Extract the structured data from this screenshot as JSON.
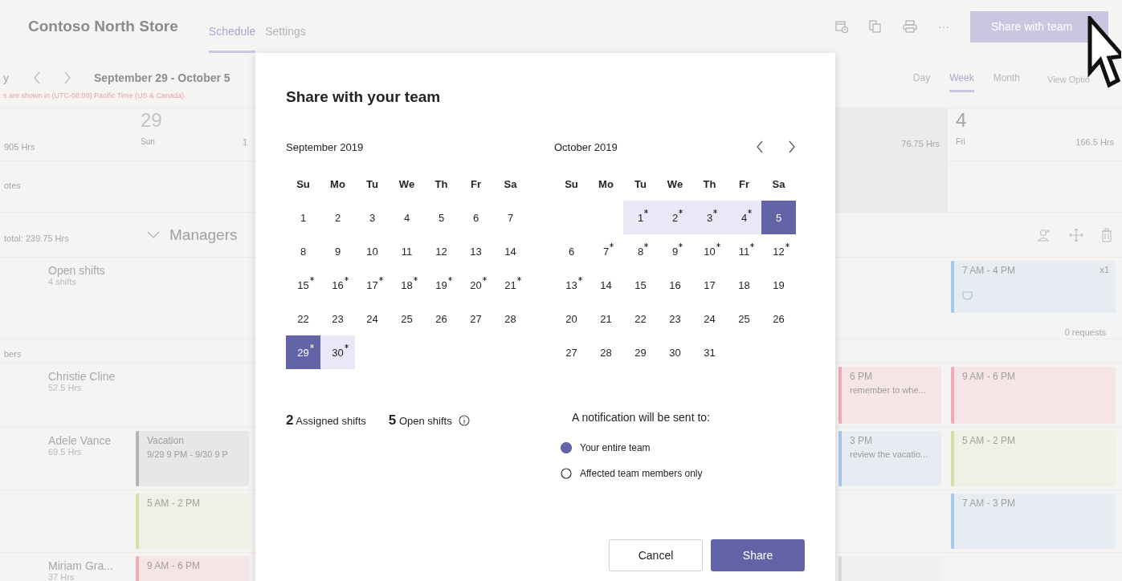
{
  "topbar": {
    "title": "Contoso North Store",
    "tabs": [
      {
        "label": "Schedule",
        "selected": true
      },
      {
        "label": "Settings",
        "selected": false
      }
    ],
    "more": "···",
    "share_button": "Share with team"
  },
  "toolbar": {
    "today_fragment": "y",
    "date_range": "September 29 - October 5",
    "timezone_note": "s are shown in (UTC-08:00) Pacific Time (US & Canada).",
    "views": [
      {
        "label": "Day",
        "selected": false
      },
      {
        "label": "Week",
        "selected": true
      },
      {
        "label": "Month",
        "selected": false
      }
    ],
    "view_options": "View Optio"
  },
  "day_header": {
    "total": "905 Hrs",
    "days": [
      {
        "kind": "sun",
        "date": "29",
        "weekday": "Sun",
        "hours": "1"
      },
      {
        "kind": "thu",
        "hours": "76.75 Hrs"
      },
      {
        "kind": "fri",
        "date": "4",
        "weekday": "Fri",
        "hours": "166.5 Hrs"
      }
    ]
  },
  "notes_label": "otes",
  "group": {
    "total": "total: 239.75 Hrs",
    "name": "Managers",
    "expanded": true
  },
  "open_shifts": {
    "name": "Open shifts",
    "hours": "4 shifts",
    "shifts": [
      {
        "kind": "fri",
        "time": "7 AM - 4 PM",
        "count": "x1",
        "color": "#a9c8e8"
      }
    ],
    "requests": "0 requests"
  },
  "members_label": "bers",
  "rows": [
    {
      "name": "Christie Cline",
      "hours": "52.5 Hrs",
      "shifts": [
        {
          "kind": "thu",
          "time": "6 PM",
          "note": "remember to whe...",
          "color": "#f2aab4"
        },
        {
          "kind": "fri",
          "time": "9 AM - 6 PM",
          "color": "#f2aab4"
        }
      ]
    },
    {
      "name": "Adele Vance",
      "hours": "69.5 Hrs",
      "shifts": [
        {
          "kind": "sun",
          "time": "Vacation",
          "note": "9/29 9 PM - 9/30 9 P",
          "color": "#b4b4b4"
        },
        {
          "kind": "thu",
          "time": "3 PM",
          "note": "review the vacatio...",
          "color": "#a9c8e8"
        },
        {
          "kind": "fri",
          "time": "5 AM - 2 PM",
          "color": "#d2e0a6"
        }
      ]
    },
    {
      "shifts": [
        {
          "kind": "sun",
          "time": "5 AM - 2 PM",
          "color": "#d2e0a6"
        },
        {
          "kind": "fri",
          "time": "7 AM - 3 PM",
          "color": "#a9c8e8"
        }
      ]
    },
    {
      "name": "Miriam Gra...",
      "hours": "37 Hrs",
      "shifts": [
        {
          "kind": "sun",
          "time": "9 AM - 6 PM",
          "color": "#f2aab4"
        },
        {
          "kind": "thu",
          "color": "#dcdcdc"
        }
      ]
    }
  ],
  "dialog": {
    "title": "Share with your team",
    "calendars": [
      {
        "month": "September 2019",
        "weekdays": [
          "Su",
          "Mo",
          "Tu",
          "We",
          "Th",
          "Fr",
          "Sa"
        ],
        "weeks": [
          [
            {
              "day": "1",
              "marked": false,
              "selected": false,
              "in_range": false
            },
            {
              "day": "2",
              "marked": false,
              "selected": false,
              "in_range": false
            },
            {
              "day": "3",
              "marked": false,
              "selected": false,
              "in_range": false
            },
            {
              "day": "4",
              "marked": false,
              "selected": false,
              "in_range": false
            },
            {
              "day": "5",
              "marked": false,
              "selected": false,
              "in_range": false
            },
            {
              "day": "6",
              "marked": false,
              "selected": false,
              "in_range": false
            },
            {
              "day": "7",
              "marked": false,
              "selected": false,
              "in_range": false
            }
          ],
          [
            {
              "day": "8",
              "marked": false,
              "selected": false,
              "in_range": false
            },
            {
              "day": "9",
              "marked": false,
              "selected": false,
              "in_range": false
            },
            {
              "day": "10",
              "marked": false,
              "selected": false,
              "in_range": false
            },
            {
              "day": "11",
              "marked": false,
              "selected": false,
              "in_range": false
            },
            {
              "day": "12",
              "marked": false,
              "selected": false,
              "in_range": false
            },
            {
              "day": "13",
              "marked": false,
              "selected": false,
              "in_range": false
            },
            {
              "day": "14",
              "marked": false,
              "selected": false,
              "in_range": false
            }
          ],
          [
            {
              "day": "15",
              "marked": true,
              "selected": false,
              "in_range": false
            },
            {
              "day": "16",
              "marked": true,
              "selected": false,
              "in_range": false
            },
            {
              "day": "17",
              "marked": true,
              "selected": false,
              "in_range": false
            },
            {
              "day": "18",
              "marked": true,
              "selected": false,
              "in_range": false
            },
            {
              "day": "19",
              "marked": true,
              "selected": false,
              "in_range": false
            },
            {
              "day": "20",
              "marked": true,
              "selected": false,
              "in_range": false
            },
            {
              "day": "21",
              "marked": true,
              "selected": false,
              "in_range": false
            }
          ],
          [
            {
              "day": "22",
              "marked": false,
              "selected": false,
              "in_range": false
            },
            {
              "day": "23",
              "marked": false,
              "selected": false,
              "in_range": false
            },
            {
              "day": "24",
              "marked": false,
              "selected": false,
              "in_range": false
            },
            {
              "day": "25",
              "marked": false,
              "selected": false,
              "in_range": false
            },
            {
              "day": "26",
              "marked": false,
              "selected": false,
              "in_range": false
            },
            {
              "day": "27",
              "marked": false,
              "selected": false,
              "in_range": false
            },
            {
              "day": "28",
              "marked": false,
              "selected": false,
              "in_range": false
            }
          ],
          [
            {
              "day": "29",
              "marked": true,
              "selected": true,
              "in_range": true
            },
            {
              "day": "30",
              "marked": true,
              "selected": false,
              "in_range": true
            }
          ]
        ]
      },
      {
        "month": "October 2019",
        "weekdays": [
          "Su",
          "Mo",
          "Tu",
          "We",
          "Th",
          "Fr",
          "Sa"
        ],
        "weeks": [
          [
            {
              "day": "1",
              "marked": true,
              "selected": false,
              "in_range": true
            },
            {
              "day": "2",
              "marked": true,
              "selected": false,
              "in_range": true
            },
            {
              "day": "3",
              "marked": true,
              "selected": false,
              "in_range": true
            },
            {
              "day": "4",
              "marked": true,
              "selected": false,
              "in_range": true
            },
            {
              "day": "5",
              "marked": false,
              "selected": true,
              "in_range": true
            }
          ],
          [
            {
              "day": "6",
              "marked": false,
              "selected": false,
              "in_range": false
            },
            {
              "day": "7",
              "marked": true,
              "selected": false,
              "in_range": false
            },
            {
              "day": "8",
              "marked": true,
              "selected": false,
              "in_range": false
            },
            {
              "day": "9",
              "marked": true,
              "selected": false,
              "in_range": false
            },
            {
              "day": "10",
              "marked": true,
              "selected": false,
              "in_range": false
            },
            {
              "day": "11",
              "marked": true,
              "selected": false,
              "in_range": false
            },
            {
              "day": "12",
              "marked": true,
              "selected": false,
              "in_range": false
            }
          ],
          [
            {
              "day": "13",
              "marked": true,
              "selected": false,
              "in_range": false
            },
            {
              "day": "14",
              "marked": false,
              "selected": false,
              "in_range": false
            },
            {
              "day": "15",
              "marked": false,
              "selected": false,
              "in_range": false
            },
            {
              "day": "16",
              "marked": false,
              "selected": false,
              "in_range": false
            },
            {
              "day": "17",
              "marked": false,
              "selected": false,
              "in_range": false
            },
            {
              "day": "18",
              "marked": false,
              "selected": false,
              "in_range": false
            },
            {
              "day": "19",
              "marked": false,
              "selected": false,
              "in_range": false
            }
          ],
          [
            {
              "day": "20",
              "marked": false,
              "selected": false,
              "in_range": false
            },
            {
              "day": "21",
              "marked": false,
              "selected": false,
              "in_range": false
            },
            {
              "day": "22",
              "marked": false,
              "selected": false,
              "in_range": false
            },
            {
              "day": "23",
              "marked": false,
              "selected": false,
              "in_range": false
            },
            {
              "day": "24",
              "marked": false,
              "selected": false,
              "in_range": false
            },
            {
              "day": "25",
              "marked": false,
              "selected": false,
              "in_range": false
            },
            {
              "day": "26",
              "marked": false,
              "selected": false,
              "in_range": false
            }
          ],
          [
            {
              "day": "27",
              "marked": false,
              "selected": false,
              "in_range": false
            },
            {
              "day": "28",
              "marked": false,
              "selected": false,
              "in_range": false
            },
            {
              "day": "29",
              "marked": false,
              "selected": false,
              "in_range": false
            },
            {
              "day": "30",
              "marked": false,
              "selected": false,
              "in_range": false
            },
            {
              "day": "31",
              "marked": false,
              "selected": false,
              "in_range": false
            }
          ]
        ]
      }
    ],
    "stats": [
      "**2** Assigned shifts",
      "**5** Open shifts"
    ],
    "notification": {
      "label": "A notification will be sent to:",
      "options": [
        {
          "label": "Your entire team",
          "selected": true
        },
        {
          "label": "Affected team members only",
          "selected": false
        }
      ]
    },
    "buttons": [
      {
        "label": "Cancel",
        "kind": "secondary"
      },
      {
        "label": "Share",
        "kind": "primary"
      }
    ]
  }
}
